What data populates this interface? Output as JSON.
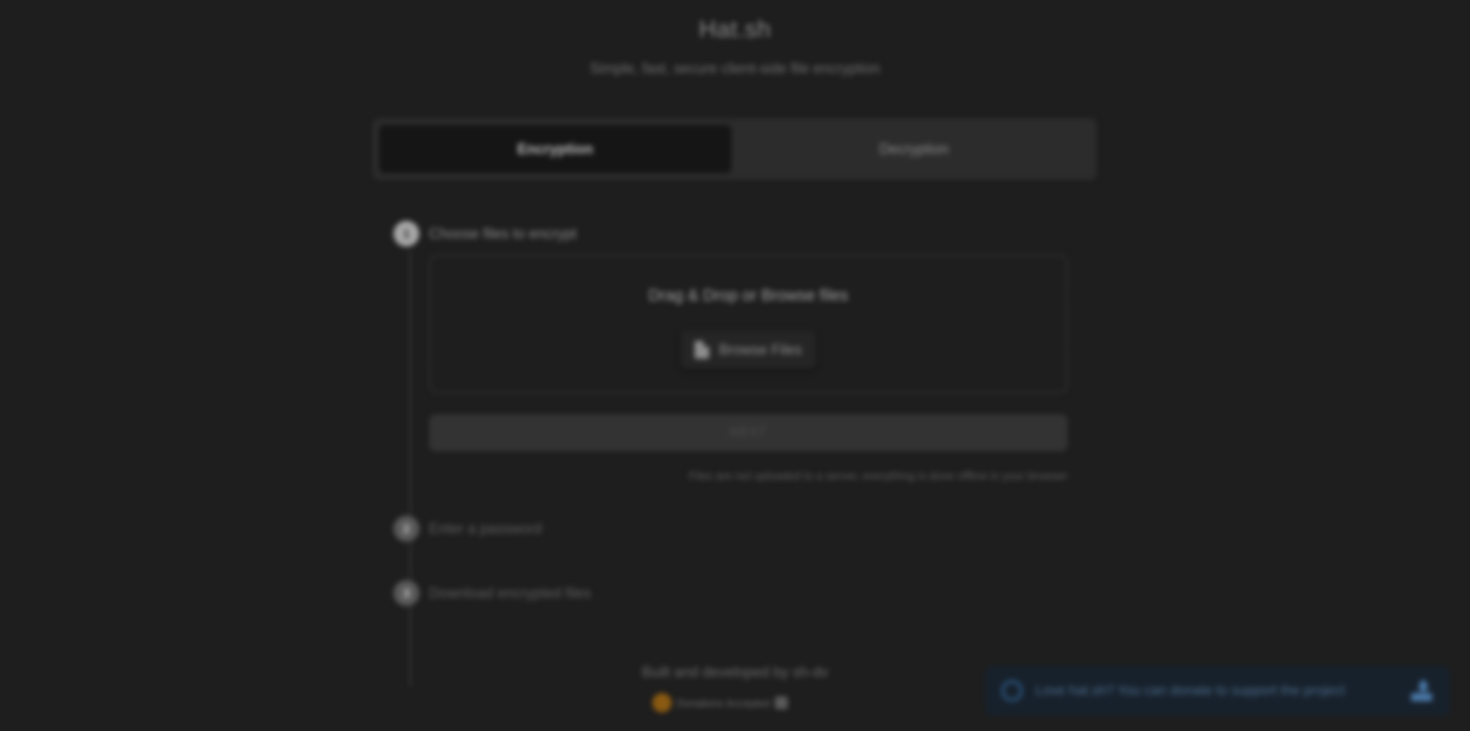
{
  "app": {
    "title": "Hat.sh",
    "subtitle": "Simple, fast, secure client-side file encryption"
  },
  "tabs": [
    {
      "label": "Encryption",
      "active": true
    },
    {
      "label": "Decryption",
      "active": false
    }
  ],
  "steps": [
    {
      "number": "1",
      "label": "Choose files to encrypt",
      "active": true
    },
    {
      "number": "2",
      "label": "Enter a password",
      "active": false
    },
    {
      "number": "3",
      "label": "Download encrypted files",
      "active": false
    }
  ],
  "dropzone": {
    "text": "Drag & Drop or Browse files",
    "browse_label": "Browse Files"
  },
  "next_label": "NEXT",
  "note": "Files are not uploaded to a server, everything is done offline in your browser",
  "footer": {
    "built_by": "Built and developed by sh-dv",
    "badge_label": "Donations Accepted"
  },
  "toast": {
    "text": "Love hat.sh? You can donate to support the project"
  },
  "colors": {
    "background": "#1e1e1e",
    "toast_bg": "#17212c",
    "accent_blue": "#4a78a8",
    "badge_orange": "#8a5a12"
  },
  "icons": {
    "browse": "file-icon",
    "toast_info": "info-icon",
    "toast_action": "donate-icon"
  }
}
